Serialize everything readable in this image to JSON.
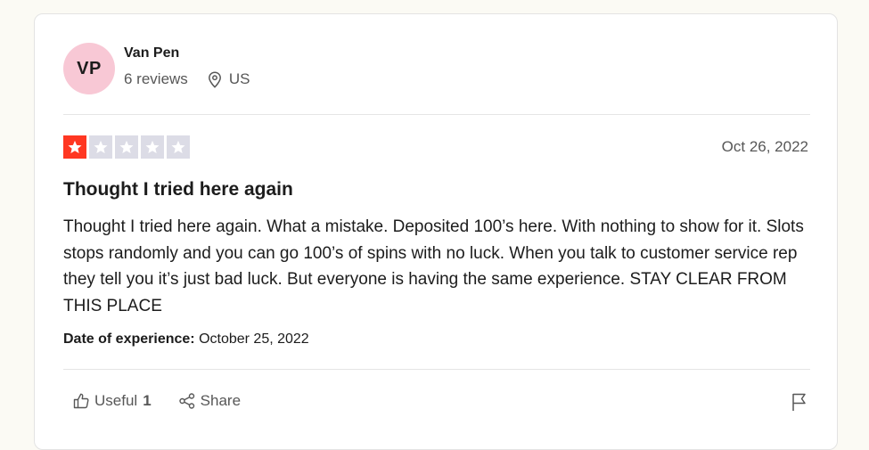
{
  "consumer": {
    "initials": "VP",
    "name": "Van Pen",
    "reviews_count": "6 reviews",
    "location": "US",
    "avatar_color": "#f8c8d5"
  },
  "review": {
    "rating": 1,
    "rating_max": 5,
    "date": "Oct 26, 2022",
    "title": "Thought I tried here again",
    "body": "Thought I tried here again. What a mistake. Deposited 100’s here. With nothing to show for it. Slots stops randomly and you can go 100’s of spins with no luck. When you talk to customer service rep they tell you it’s just bad luck. But everyone is having the same experience. STAY CLEAR FROM THIS PLACE",
    "experience_label": "Date of experience:",
    "experience_date": "October 25, 2022",
    "star_color": "#ff3722"
  },
  "actions": {
    "useful_label": "Useful",
    "useful_count": "1",
    "share_label": "Share",
    "icons": [
      "thumbs-up-icon",
      "share-icon",
      "flag-icon"
    ]
  }
}
